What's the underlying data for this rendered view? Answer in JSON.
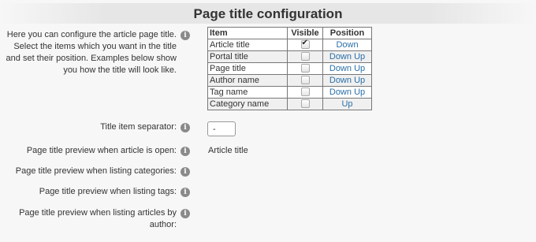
{
  "page": {
    "title": "Page title configuration",
    "description": "Here you can configure the article page title. Select the items which you want in the title and set their position. Examples below show you how the title will look like."
  },
  "table": {
    "headers": {
      "item": "Item",
      "visible": "Visible",
      "position": "Position"
    },
    "rows": [
      {
        "item": "Article title",
        "visible": true,
        "down": "Down",
        "up": ""
      },
      {
        "item": "Portal title",
        "visible": false,
        "down": "Down",
        "up": "Up"
      },
      {
        "item": "Page title",
        "visible": false,
        "down": "Down",
        "up": "Up"
      },
      {
        "item": "Author name",
        "visible": false,
        "down": "Down",
        "up": "Up"
      },
      {
        "item": "Tag name",
        "visible": false,
        "down": "Down",
        "up": "Up"
      },
      {
        "item": "Category name",
        "visible": false,
        "down": "",
        "up": "Up"
      }
    ]
  },
  "settings": {
    "separator_label": "Title item separator:",
    "separator_value": "-",
    "preview_article_label": "Page title preview when article is open:",
    "preview_article_value": "Article title",
    "preview_categories_label": "Page title preview when listing categories:",
    "preview_tags_label": "Page title preview when listing tags:",
    "preview_author_label_1": "Page title preview when listing articles by",
    "preview_author_label_2": "author:"
  }
}
